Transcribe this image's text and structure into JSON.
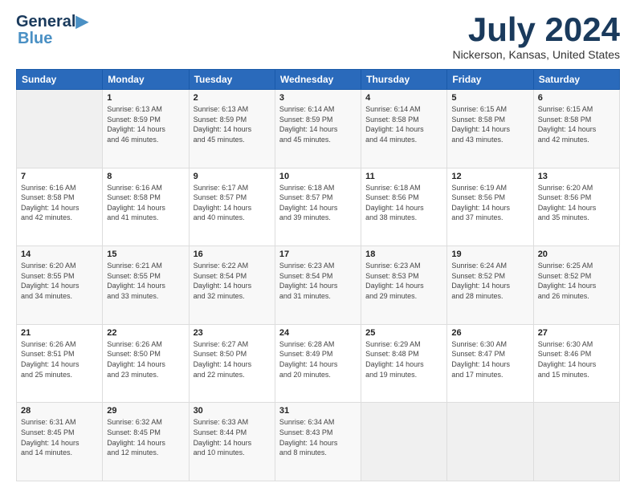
{
  "logo": {
    "line1": "General",
    "line2": "Blue"
  },
  "header": {
    "month": "July 2024",
    "location": "Nickerson, Kansas, United States"
  },
  "days_of_week": [
    "Sunday",
    "Monday",
    "Tuesday",
    "Wednesday",
    "Thursday",
    "Friday",
    "Saturday"
  ],
  "weeks": [
    [
      {
        "day": "",
        "info": ""
      },
      {
        "day": "1",
        "info": "Sunrise: 6:13 AM\nSunset: 8:59 PM\nDaylight: 14 hours\nand 46 minutes."
      },
      {
        "day": "2",
        "info": "Sunrise: 6:13 AM\nSunset: 8:59 PM\nDaylight: 14 hours\nand 45 minutes."
      },
      {
        "day": "3",
        "info": "Sunrise: 6:14 AM\nSunset: 8:59 PM\nDaylight: 14 hours\nand 45 minutes."
      },
      {
        "day": "4",
        "info": "Sunrise: 6:14 AM\nSunset: 8:58 PM\nDaylight: 14 hours\nand 44 minutes."
      },
      {
        "day": "5",
        "info": "Sunrise: 6:15 AM\nSunset: 8:58 PM\nDaylight: 14 hours\nand 43 minutes."
      },
      {
        "day": "6",
        "info": "Sunrise: 6:15 AM\nSunset: 8:58 PM\nDaylight: 14 hours\nand 42 minutes."
      }
    ],
    [
      {
        "day": "7",
        "info": "Sunrise: 6:16 AM\nSunset: 8:58 PM\nDaylight: 14 hours\nand 42 minutes."
      },
      {
        "day": "8",
        "info": "Sunrise: 6:16 AM\nSunset: 8:58 PM\nDaylight: 14 hours\nand 41 minutes."
      },
      {
        "day": "9",
        "info": "Sunrise: 6:17 AM\nSunset: 8:57 PM\nDaylight: 14 hours\nand 40 minutes."
      },
      {
        "day": "10",
        "info": "Sunrise: 6:18 AM\nSunset: 8:57 PM\nDaylight: 14 hours\nand 39 minutes."
      },
      {
        "day": "11",
        "info": "Sunrise: 6:18 AM\nSunset: 8:56 PM\nDaylight: 14 hours\nand 38 minutes."
      },
      {
        "day": "12",
        "info": "Sunrise: 6:19 AM\nSunset: 8:56 PM\nDaylight: 14 hours\nand 37 minutes."
      },
      {
        "day": "13",
        "info": "Sunrise: 6:20 AM\nSunset: 8:56 PM\nDaylight: 14 hours\nand 35 minutes."
      }
    ],
    [
      {
        "day": "14",
        "info": "Sunrise: 6:20 AM\nSunset: 8:55 PM\nDaylight: 14 hours\nand 34 minutes."
      },
      {
        "day": "15",
        "info": "Sunrise: 6:21 AM\nSunset: 8:55 PM\nDaylight: 14 hours\nand 33 minutes."
      },
      {
        "day": "16",
        "info": "Sunrise: 6:22 AM\nSunset: 8:54 PM\nDaylight: 14 hours\nand 32 minutes."
      },
      {
        "day": "17",
        "info": "Sunrise: 6:23 AM\nSunset: 8:54 PM\nDaylight: 14 hours\nand 31 minutes."
      },
      {
        "day": "18",
        "info": "Sunrise: 6:23 AM\nSunset: 8:53 PM\nDaylight: 14 hours\nand 29 minutes."
      },
      {
        "day": "19",
        "info": "Sunrise: 6:24 AM\nSunset: 8:52 PM\nDaylight: 14 hours\nand 28 minutes."
      },
      {
        "day": "20",
        "info": "Sunrise: 6:25 AM\nSunset: 8:52 PM\nDaylight: 14 hours\nand 26 minutes."
      }
    ],
    [
      {
        "day": "21",
        "info": "Sunrise: 6:26 AM\nSunset: 8:51 PM\nDaylight: 14 hours\nand 25 minutes."
      },
      {
        "day": "22",
        "info": "Sunrise: 6:26 AM\nSunset: 8:50 PM\nDaylight: 14 hours\nand 23 minutes."
      },
      {
        "day": "23",
        "info": "Sunrise: 6:27 AM\nSunset: 8:50 PM\nDaylight: 14 hours\nand 22 minutes."
      },
      {
        "day": "24",
        "info": "Sunrise: 6:28 AM\nSunset: 8:49 PM\nDaylight: 14 hours\nand 20 minutes."
      },
      {
        "day": "25",
        "info": "Sunrise: 6:29 AM\nSunset: 8:48 PM\nDaylight: 14 hours\nand 19 minutes."
      },
      {
        "day": "26",
        "info": "Sunrise: 6:30 AM\nSunset: 8:47 PM\nDaylight: 14 hours\nand 17 minutes."
      },
      {
        "day": "27",
        "info": "Sunrise: 6:30 AM\nSunset: 8:46 PM\nDaylight: 14 hours\nand 15 minutes."
      }
    ],
    [
      {
        "day": "28",
        "info": "Sunrise: 6:31 AM\nSunset: 8:45 PM\nDaylight: 14 hours\nand 14 minutes."
      },
      {
        "day": "29",
        "info": "Sunrise: 6:32 AM\nSunset: 8:45 PM\nDaylight: 14 hours\nand 12 minutes."
      },
      {
        "day": "30",
        "info": "Sunrise: 6:33 AM\nSunset: 8:44 PM\nDaylight: 14 hours\nand 10 minutes."
      },
      {
        "day": "31",
        "info": "Sunrise: 6:34 AM\nSunset: 8:43 PM\nDaylight: 14 hours\nand 8 minutes."
      },
      {
        "day": "",
        "info": ""
      },
      {
        "day": "",
        "info": ""
      },
      {
        "day": "",
        "info": ""
      }
    ]
  ]
}
